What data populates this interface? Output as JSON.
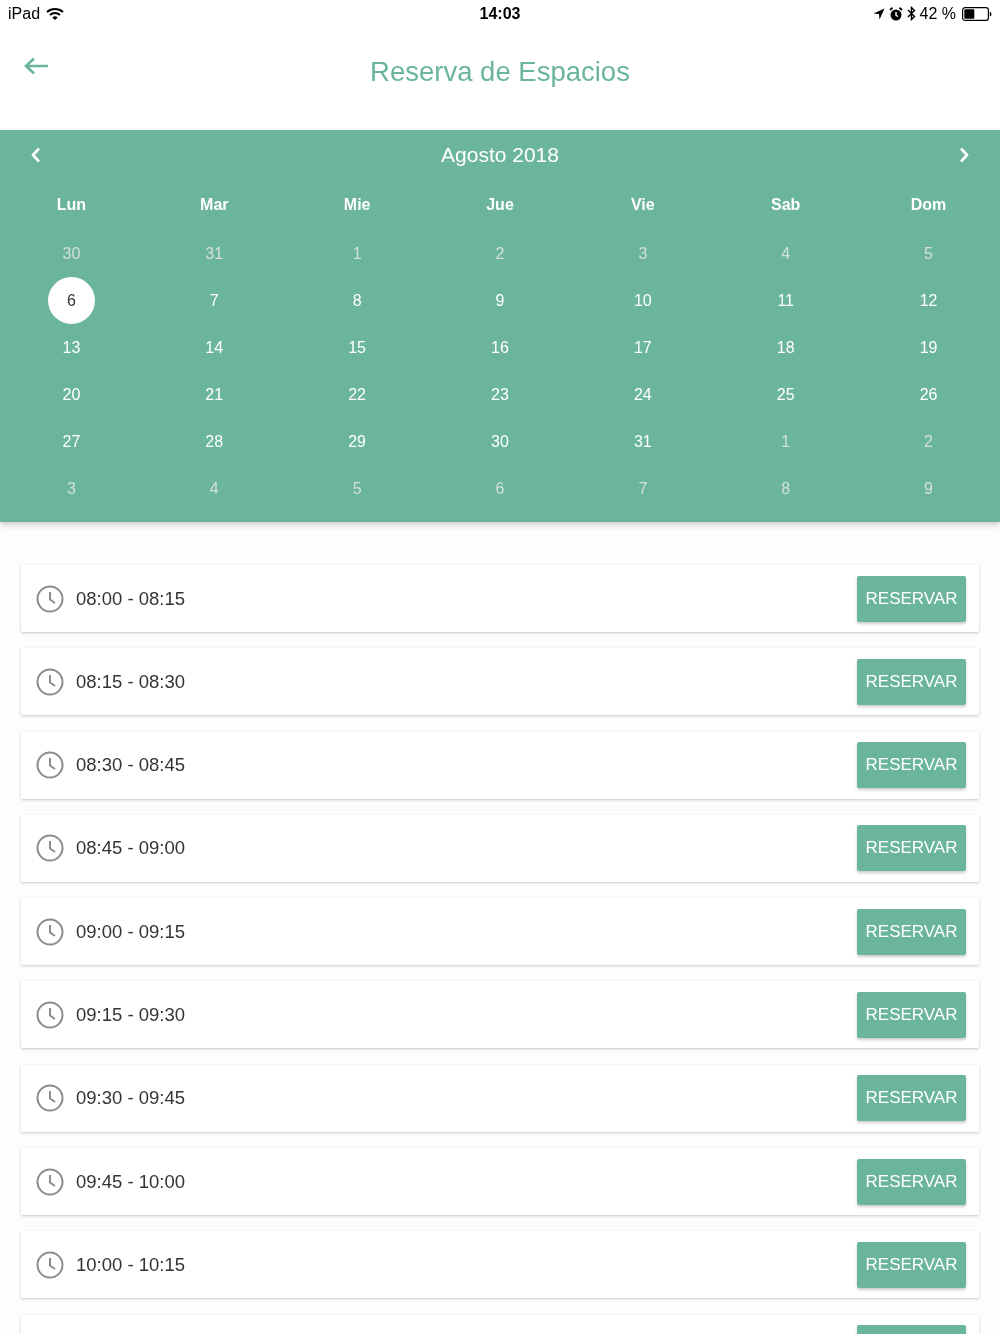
{
  "status_bar": {
    "device": "iPad",
    "time": "14:03",
    "battery": "42 %"
  },
  "header": {
    "title": "Reserva de Espacios"
  },
  "calendar": {
    "month": "Agosto 2018",
    "weekdays": [
      "Lun",
      "Mar",
      "Mie",
      "Jue",
      "Vie",
      "Sab",
      "Dom"
    ],
    "weeks": [
      [
        {
          "day": "30",
          "outside": true,
          "selected": false
        },
        {
          "day": "31",
          "outside": true,
          "selected": false
        },
        {
          "day": "1",
          "outside": true,
          "selected": false
        },
        {
          "day": "2",
          "outside": true,
          "selected": false
        },
        {
          "day": "3",
          "outside": true,
          "selected": false
        },
        {
          "day": "4",
          "outside": true,
          "selected": false
        },
        {
          "day": "5",
          "outside": true,
          "selected": false
        }
      ],
      [
        {
          "day": "6",
          "outside": false,
          "selected": true
        },
        {
          "day": "7",
          "outside": false,
          "selected": false
        },
        {
          "day": "8",
          "outside": false,
          "selected": false
        },
        {
          "day": "9",
          "outside": false,
          "selected": false
        },
        {
          "day": "10",
          "outside": false,
          "selected": false
        },
        {
          "day": "11",
          "outside": false,
          "selected": false
        },
        {
          "day": "12",
          "outside": false,
          "selected": false
        }
      ],
      [
        {
          "day": "13",
          "outside": false,
          "selected": false
        },
        {
          "day": "14",
          "outside": false,
          "selected": false
        },
        {
          "day": "15",
          "outside": false,
          "selected": false
        },
        {
          "day": "16",
          "outside": false,
          "selected": false
        },
        {
          "day": "17",
          "outside": false,
          "selected": false
        },
        {
          "day": "18",
          "outside": false,
          "selected": false
        },
        {
          "day": "19",
          "outside": false,
          "selected": false
        }
      ],
      [
        {
          "day": "20",
          "outside": false,
          "selected": false
        },
        {
          "day": "21",
          "outside": false,
          "selected": false
        },
        {
          "day": "22",
          "outside": false,
          "selected": false
        },
        {
          "day": "23",
          "outside": false,
          "selected": false
        },
        {
          "day": "24",
          "outside": false,
          "selected": false
        },
        {
          "day": "25",
          "outside": false,
          "selected": false
        },
        {
          "day": "26",
          "outside": false,
          "selected": false
        }
      ],
      [
        {
          "day": "27",
          "outside": false,
          "selected": false
        },
        {
          "day": "28",
          "outside": false,
          "selected": false
        },
        {
          "day": "29",
          "outside": false,
          "selected": false
        },
        {
          "day": "30",
          "outside": false,
          "selected": false
        },
        {
          "day": "31",
          "outside": false,
          "selected": false
        },
        {
          "day": "1",
          "outside": true,
          "selected": false
        },
        {
          "day": "2",
          "outside": true,
          "selected": false
        }
      ],
      [
        {
          "day": "3",
          "outside": true,
          "selected": false
        },
        {
          "day": "4",
          "outside": true,
          "selected": false
        },
        {
          "day": "5",
          "outside": true,
          "selected": false
        },
        {
          "day": "6",
          "outside": true,
          "selected": false
        },
        {
          "day": "7",
          "outside": true,
          "selected": false
        },
        {
          "day": "8",
          "outside": true,
          "selected": false
        },
        {
          "day": "9",
          "outside": true,
          "selected": false
        }
      ]
    ]
  },
  "slots": [
    {
      "time": "08:00 - 08:15",
      "button": "RESERVAR"
    },
    {
      "time": "08:15 - 08:30",
      "button": "RESERVAR"
    },
    {
      "time": "08:30 - 08:45",
      "button": "RESERVAR"
    },
    {
      "time": "08:45 - 09:00",
      "button": "RESERVAR"
    },
    {
      "time": "09:00 - 09:15",
      "button": "RESERVAR"
    },
    {
      "time": "09:15 - 09:30",
      "button": "RESERVAR"
    },
    {
      "time": "09:30 - 09:45",
      "button": "RESERVAR"
    },
    {
      "time": "09:45 - 10:00",
      "button": "RESERVAR"
    },
    {
      "time": "10:00 - 10:15",
      "button": "RESERVAR"
    }
  ]
}
